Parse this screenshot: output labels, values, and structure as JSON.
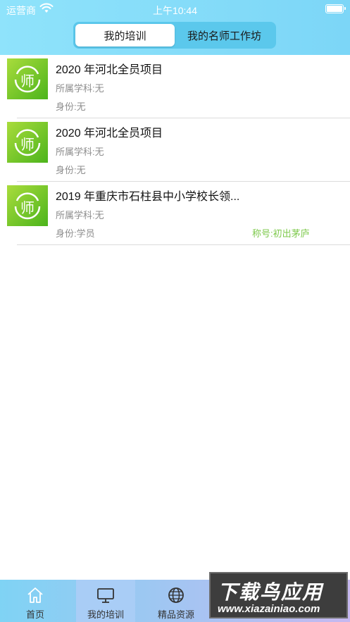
{
  "status_bar": {
    "carrier": "运营商",
    "time": "上午10:44"
  },
  "segmented": {
    "tabs": [
      {
        "label": "我的培训",
        "active": true
      },
      {
        "label": "我的名师工作坊",
        "active": false
      }
    ]
  },
  "trainings": [
    {
      "title": "2020 年河北全员项目",
      "subject": "所属学科:无",
      "identity": "身份:无",
      "rank": ""
    },
    {
      "title": "2020 年河北全员项目",
      "subject": "所属学科:无",
      "identity": "身份:无",
      "rank": ""
    },
    {
      "title": "2019 年重庆市石柱县中小学校长领...",
      "subject": "所属学科:无",
      "identity": "身份:学员",
      "rank": "称号:初出茅庐"
    }
  ],
  "tab_bar": {
    "items": [
      {
        "label": "首页",
        "icon": "home-icon"
      },
      {
        "label": "我的培训",
        "icon": "monitor-icon",
        "active": true
      },
      {
        "label": "精品资源",
        "icon": "globe-icon"
      }
    ]
  },
  "watermark": {
    "line1": "下载鸟应用",
    "line2": "www.xiazainiao.com"
  },
  "colors": {
    "header": "#8fe3fb",
    "accent_green": "#7dc94b",
    "logo_green": "#4cb41c"
  }
}
